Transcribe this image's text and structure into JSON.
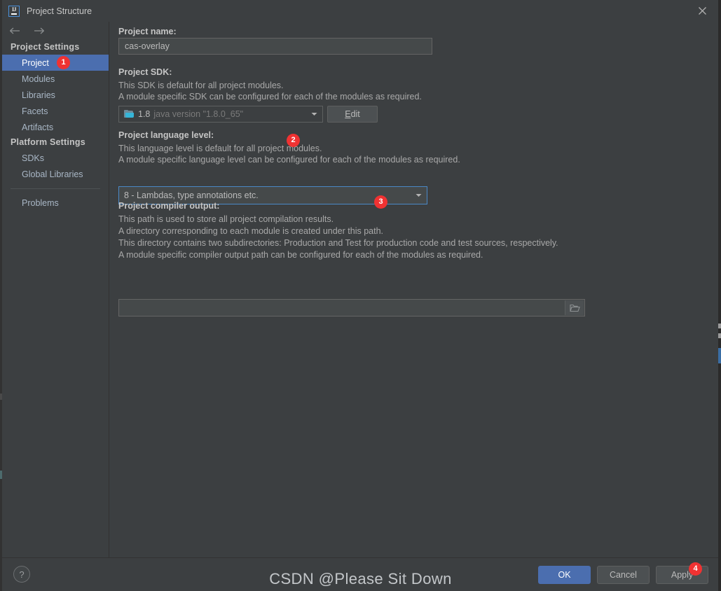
{
  "window": {
    "title": "Project Structure",
    "app_icon": "intellij-idea-icon",
    "close_icon": "close-icon",
    "back_icon": "arrow-left-icon",
    "forward_icon": "arrow-right-icon"
  },
  "sidebar": {
    "groups": [
      {
        "header": "Project Settings",
        "items": [
          {
            "label": "Project",
            "selected": true,
            "badge": "1"
          },
          {
            "label": "Modules",
            "selected": false
          },
          {
            "label": "Libraries",
            "selected": false
          },
          {
            "label": "Facets",
            "selected": false
          },
          {
            "label": "Artifacts",
            "selected": false
          }
        ]
      },
      {
        "header": "Platform Settings",
        "items": [
          {
            "label": "SDKs",
            "selected": false
          },
          {
            "label": "Global Libraries",
            "selected": false
          }
        ]
      }
    ],
    "problems": {
      "label": "Problems"
    }
  },
  "main": {
    "project_name": {
      "label": "Project name:",
      "value": "cas-overlay",
      "placeholder": ""
    },
    "project_sdk": {
      "label": "Project SDK:",
      "descriptions": [
        "This SDK is default for all project modules.",
        "A module specific SDK can be configured for each of the modules as required."
      ],
      "selected_version": "1.8",
      "selected_detail": "java version \"1.8.0_65\"",
      "sdk_icon": "java-sdk-folder-icon",
      "dropdown_icon": "chevron-down-icon",
      "badge": "2",
      "edit_button": {
        "label": "Edit",
        "mnemonic": "E"
      }
    },
    "project_language_level": {
      "label": "Project language level:",
      "descriptions": [
        "This language level is default for all project modules.",
        "A module specific language level can be configured for each of the modules as required."
      ],
      "selected": "8 - Lambdas, type annotations etc.",
      "dropdown_icon": "chevron-down-icon",
      "badge": "3",
      "focused": true
    },
    "project_compiler_output": {
      "label": "Project compiler output:",
      "descriptions": [
        "This path is used to store all project compilation results.",
        "A directory corresponding to each module is created under this path.",
        "This directory contains two subdirectories: Production and Test for production code and test sources, respectively.",
        "A module specific compiler output path can be configured for each of the modules as required."
      ],
      "value": "",
      "placeholder": "",
      "browse_icon": "folder-browse-icon"
    }
  },
  "bottom": {
    "help": {
      "label": "?",
      "icon": "help-icon"
    },
    "buttons": [
      {
        "label": "OK",
        "style": "primary"
      },
      {
        "label": "Cancel",
        "style": "normal"
      },
      {
        "label": "Apply",
        "style": "normal",
        "badge": "4"
      }
    ]
  },
  "overlay": {
    "watermark": "CSDN @Please Sit Down"
  },
  "colors": {
    "window_bg": "#3c3f41",
    "selection_blue": "#4b6eaf",
    "badge_red": "#f03232",
    "focus_border": "#4a88c7",
    "text": "#a9b7c6",
    "sdk_icon_cyan": "#35b5d8"
  }
}
